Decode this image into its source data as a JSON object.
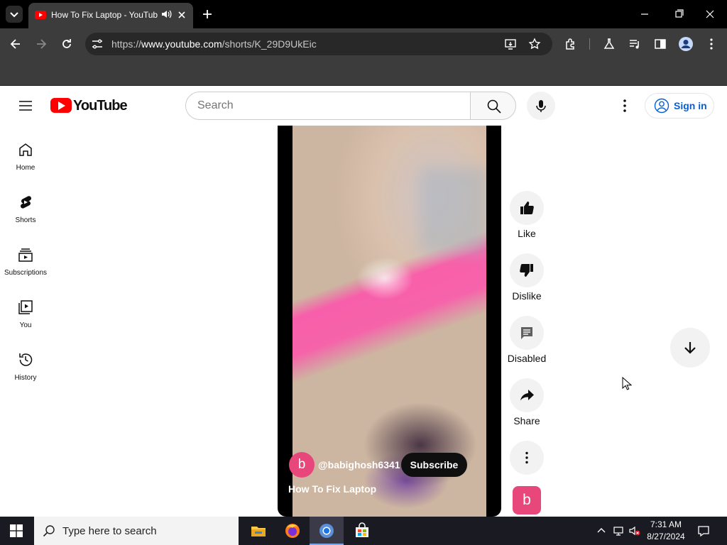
{
  "browser": {
    "tab_title": "How To Fix Laptop - YouTube",
    "url_prefix": "https://",
    "url_host": "www.youtube.com",
    "url_path": "/shorts/K_29D9UkEic"
  },
  "youtube": {
    "logo_text": "YouTube",
    "search_placeholder": "Search",
    "signin_label": "Sign in",
    "guide": [
      {
        "label": "Home",
        "icon": "home-icon"
      },
      {
        "label": "Shorts",
        "icon": "shorts-icon"
      },
      {
        "label": "Subscriptions",
        "icon": "subscriptions-icon"
      },
      {
        "label": "You",
        "icon": "you-icon"
      },
      {
        "label": "History",
        "icon": "history-icon"
      }
    ],
    "short": {
      "channel_avatar_letter": "b",
      "channel_handle": "@babighosh6341",
      "subscribe_label": "Subscribe",
      "title": "How To Fix Laptop"
    },
    "actions": {
      "like": "Like",
      "dislike": "Dislike",
      "comments": "Disabled",
      "share": "Share"
    },
    "sound_avatar_letter": "b"
  },
  "taskbar": {
    "search_placeholder": "Type here to search",
    "time": "7:31 AM",
    "date": "8/27/2024"
  },
  "colors": {
    "youtube_red": "#ff0000",
    "avatar_pink": "#e8477c",
    "link_blue": "#065fd4"
  }
}
